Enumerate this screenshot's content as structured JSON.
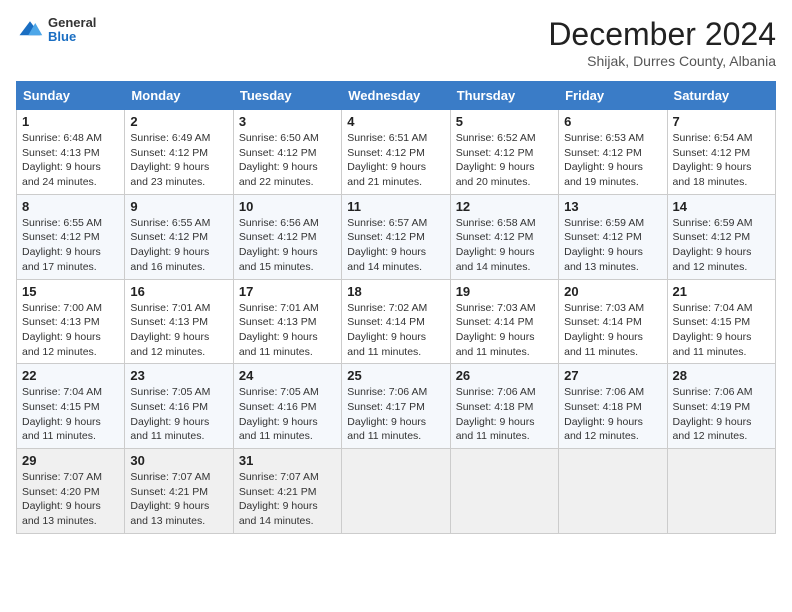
{
  "header": {
    "logo_general": "General",
    "logo_blue": "Blue",
    "month": "December 2024",
    "location": "Shijak, Durres County, Albania"
  },
  "days_of_week": [
    "Sunday",
    "Monday",
    "Tuesday",
    "Wednesday",
    "Thursday",
    "Friday",
    "Saturday"
  ],
  "weeks": [
    [
      {
        "day": "1",
        "info": "Sunrise: 6:48 AM\nSunset: 4:13 PM\nDaylight: 9 hours and 24 minutes."
      },
      {
        "day": "2",
        "info": "Sunrise: 6:49 AM\nSunset: 4:12 PM\nDaylight: 9 hours and 23 minutes."
      },
      {
        "day": "3",
        "info": "Sunrise: 6:50 AM\nSunset: 4:12 PM\nDaylight: 9 hours and 22 minutes."
      },
      {
        "day": "4",
        "info": "Sunrise: 6:51 AM\nSunset: 4:12 PM\nDaylight: 9 hours and 21 minutes."
      },
      {
        "day": "5",
        "info": "Sunrise: 6:52 AM\nSunset: 4:12 PM\nDaylight: 9 hours and 20 minutes."
      },
      {
        "day": "6",
        "info": "Sunrise: 6:53 AM\nSunset: 4:12 PM\nDaylight: 9 hours and 19 minutes."
      },
      {
        "day": "7",
        "info": "Sunrise: 6:54 AM\nSunset: 4:12 PM\nDaylight: 9 hours and 18 minutes."
      }
    ],
    [
      {
        "day": "8",
        "info": "Sunrise: 6:55 AM\nSunset: 4:12 PM\nDaylight: 9 hours and 17 minutes."
      },
      {
        "day": "9",
        "info": "Sunrise: 6:55 AM\nSunset: 4:12 PM\nDaylight: 9 hours and 16 minutes."
      },
      {
        "day": "10",
        "info": "Sunrise: 6:56 AM\nSunset: 4:12 PM\nDaylight: 9 hours and 15 minutes."
      },
      {
        "day": "11",
        "info": "Sunrise: 6:57 AM\nSunset: 4:12 PM\nDaylight: 9 hours and 14 minutes."
      },
      {
        "day": "12",
        "info": "Sunrise: 6:58 AM\nSunset: 4:12 PM\nDaylight: 9 hours and 14 minutes."
      },
      {
        "day": "13",
        "info": "Sunrise: 6:59 AM\nSunset: 4:12 PM\nDaylight: 9 hours and 13 minutes."
      },
      {
        "day": "14",
        "info": "Sunrise: 6:59 AM\nSunset: 4:12 PM\nDaylight: 9 hours and 12 minutes."
      }
    ],
    [
      {
        "day": "15",
        "info": "Sunrise: 7:00 AM\nSunset: 4:13 PM\nDaylight: 9 hours and 12 minutes."
      },
      {
        "day": "16",
        "info": "Sunrise: 7:01 AM\nSunset: 4:13 PM\nDaylight: 9 hours and 12 minutes."
      },
      {
        "day": "17",
        "info": "Sunrise: 7:01 AM\nSunset: 4:13 PM\nDaylight: 9 hours and 11 minutes."
      },
      {
        "day": "18",
        "info": "Sunrise: 7:02 AM\nSunset: 4:14 PM\nDaylight: 9 hours and 11 minutes."
      },
      {
        "day": "19",
        "info": "Sunrise: 7:03 AM\nSunset: 4:14 PM\nDaylight: 9 hours and 11 minutes."
      },
      {
        "day": "20",
        "info": "Sunrise: 7:03 AM\nSunset: 4:14 PM\nDaylight: 9 hours and 11 minutes."
      },
      {
        "day": "21",
        "info": "Sunrise: 7:04 AM\nSunset: 4:15 PM\nDaylight: 9 hours and 11 minutes."
      }
    ],
    [
      {
        "day": "22",
        "info": "Sunrise: 7:04 AM\nSunset: 4:15 PM\nDaylight: 9 hours and 11 minutes."
      },
      {
        "day": "23",
        "info": "Sunrise: 7:05 AM\nSunset: 4:16 PM\nDaylight: 9 hours and 11 minutes."
      },
      {
        "day": "24",
        "info": "Sunrise: 7:05 AM\nSunset: 4:16 PM\nDaylight: 9 hours and 11 minutes."
      },
      {
        "day": "25",
        "info": "Sunrise: 7:06 AM\nSunset: 4:17 PM\nDaylight: 9 hours and 11 minutes."
      },
      {
        "day": "26",
        "info": "Sunrise: 7:06 AM\nSunset: 4:18 PM\nDaylight: 9 hours and 11 minutes."
      },
      {
        "day": "27",
        "info": "Sunrise: 7:06 AM\nSunset: 4:18 PM\nDaylight: 9 hours and 12 minutes."
      },
      {
        "day": "28",
        "info": "Sunrise: 7:06 AM\nSunset: 4:19 PM\nDaylight: 9 hours and 12 minutes."
      }
    ],
    [
      {
        "day": "29",
        "info": "Sunrise: 7:07 AM\nSunset: 4:20 PM\nDaylight: 9 hours and 13 minutes."
      },
      {
        "day": "30",
        "info": "Sunrise: 7:07 AM\nSunset: 4:21 PM\nDaylight: 9 hours and 13 minutes."
      },
      {
        "day": "31",
        "info": "Sunrise: 7:07 AM\nSunset: 4:21 PM\nDaylight: 9 hours and 14 minutes."
      },
      {
        "day": "",
        "info": ""
      },
      {
        "day": "",
        "info": ""
      },
      {
        "day": "",
        "info": ""
      },
      {
        "day": "",
        "info": ""
      }
    ]
  ]
}
